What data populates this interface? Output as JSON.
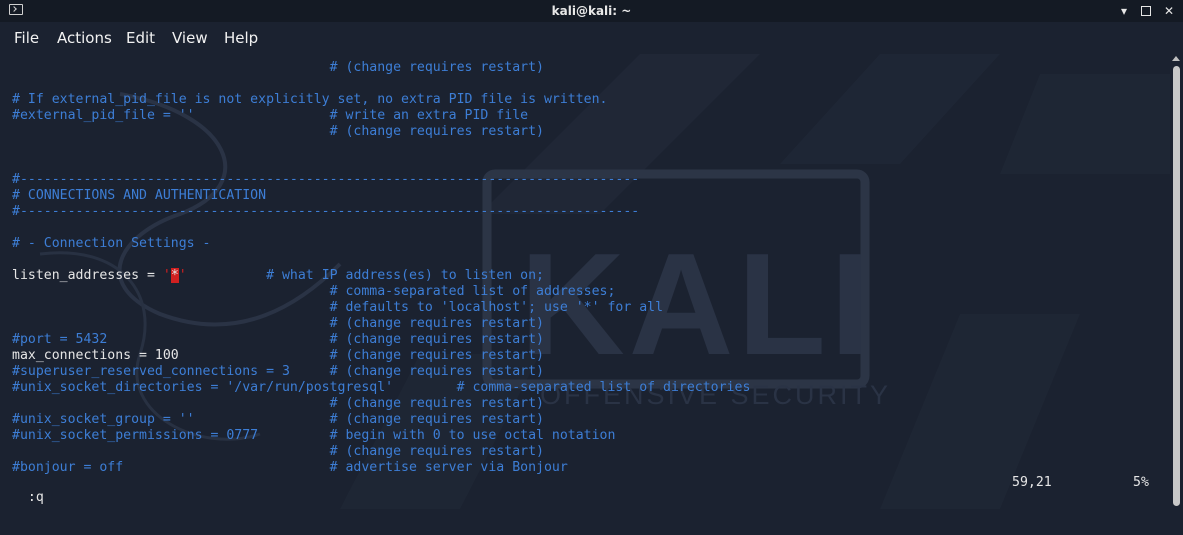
{
  "window": {
    "title": "kali@kali: ~"
  },
  "menu": {
    "items": [
      "File",
      "Actions",
      "Edit",
      "View",
      "Help"
    ]
  },
  "editor": {
    "lines": [
      {
        "parts": [
          {
            "t": "                                        # (change requires restart)",
            "c": "c"
          }
        ]
      },
      {
        "parts": []
      },
      {
        "parts": [
          {
            "t": "# If external_pid_file is not explicitly set, no extra PID file is written.",
            "c": "c"
          }
        ]
      },
      {
        "parts": [
          {
            "t": "#external_pid_file = ''                 # write an extra PID file",
            "c": "c"
          }
        ]
      },
      {
        "parts": [
          {
            "t": "                                        # (change requires restart)",
            "c": "c"
          }
        ]
      },
      {
        "parts": []
      },
      {
        "parts": []
      },
      {
        "parts": [
          {
            "t": "#------------------------------------------------------------------------------",
            "c": "c"
          }
        ]
      },
      {
        "parts": [
          {
            "t": "# CONNECTIONS AND AUTHENTICATION",
            "c": "c"
          }
        ]
      },
      {
        "parts": [
          {
            "t": "#------------------------------------------------------------------------------",
            "c": "c"
          }
        ]
      },
      {
        "parts": []
      },
      {
        "parts": [
          {
            "t": "# - Connection Settings -",
            "c": "c"
          }
        ]
      },
      {
        "parts": []
      },
      {
        "parts": [
          {
            "t": "listen_addresses = ",
            "c": "w"
          },
          {
            "t": "'",
            "c": "q"
          },
          {
            "t": "*",
            "c": "hl-star"
          },
          {
            "t": "'",
            "c": "q"
          },
          {
            "t": "          # what IP address(es) to listen on;",
            "c": "c"
          }
        ]
      },
      {
        "parts": [
          {
            "t": "                                        # comma-separated list of addresses;",
            "c": "c"
          }
        ]
      },
      {
        "parts": [
          {
            "t": "                                        # defaults to 'localhost'; use '*' for all",
            "c": "c"
          }
        ]
      },
      {
        "parts": [
          {
            "t": "                                        # (change requires restart)",
            "c": "c"
          }
        ]
      },
      {
        "parts": [
          {
            "t": "#port = 5432                            # (change requires restart)",
            "c": "c"
          }
        ]
      },
      {
        "parts": [
          {
            "t": "max_connections = 100",
            "c": "w"
          },
          {
            "t": "                   # (change requires restart)",
            "c": "c"
          }
        ]
      },
      {
        "parts": [
          {
            "t": "#superuser_reserved_connections = 3     # (change requires restart)",
            "c": "c"
          }
        ]
      },
      {
        "parts": [
          {
            "t": "#unix_socket_directories = '/var/run/postgresql'        # comma-separated list of directories",
            "c": "c"
          }
        ]
      },
      {
        "parts": [
          {
            "t": "                                        # (change requires restart)",
            "c": "c"
          }
        ]
      },
      {
        "parts": [
          {
            "t": "#unix_socket_group = ''                 # (change requires restart)",
            "c": "c"
          }
        ]
      },
      {
        "parts": [
          {
            "t": "#unix_socket_permissions = 0777         # begin with 0 to use octal notation",
            "c": "c"
          }
        ]
      },
      {
        "parts": [
          {
            "t": "                                        # (change requires restart)",
            "c": "c"
          }
        ]
      },
      {
        "parts": [
          {
            "t": "#bonjour = off                          # advertise server via Bonjour",
            "c": "c"
          }
        ]
      }
    ]
  },
  "statusline": {
    "command": ":q",
    "position": "59,21",
    "percent": "5%"
  },
  "watermark": {
    "brand": "KALI",
    "tagline": "OFFENSIVE SECURITY"
  },
  "colors": {
    "background": "#1b2230",
    "comment": "#3d7ed6",
    "text": "#e6e6e6",
    "highlight": "#d02020"
  }
}
